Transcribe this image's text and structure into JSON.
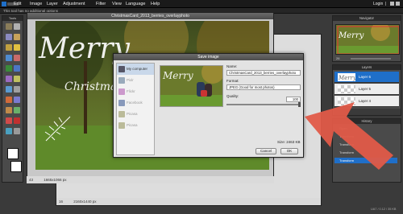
{
  "menu": [
    "Edit",
    "Image",
    "Layer",
    "Adjustment",
    "Filter",
    "View",
    "Language",
    "Help"
  ],
  "right_links": [
    "Login",
    "|"
  ],
  "info_text": "This tool has no additional options",
  "tools_title": "Tools",
  "document": {
    "title": "ChristmasCard_2013_berries_overlayphoto",
    "zoom": "43",
    "size": "1665x1066 px"
  },
  "document2": {
    "zoom": "16",
    "size": "2160x1440 px"
  },
  "overlay_text": [
    "Merry",
    "Christmas"
  ],
  "dialog": {
    "title": "Save image",
    "sources": [
      "My computer",
      "Pixlr",
      "Flickr",
      "Facebook",
      "Picasa",
      "Picasa"
    ],
    "name_label": "Name:",
    "name_value": "ChristmasCard_2013_berries_overlayphoto",
    "format_label": "Format:",
    "format_value": "JPEG (Good for most photos)",
    "quality_label": "Quality:",
    "quality_value": "100",
    "size_text": "Size: 2463 KB",
    "cancel_label": "Cancel",
    "ok_label": "OK"
  },
  "navigator": {
    "title": "Navigator",
    "zoom": "26"
  },
  "layers": {
    "title": "Layers",
    "items": [
      "Layer 6",
      "Layer 5",
      "Layer 4"
    ]
  },
  "history": {
    "title": "History",
    "items": [
      "Open",
      "Transform",
      "Transform",
      "Transform",
      "Transform"
    ]
  },
  "footer_right": "UA7 / 0.12 / 35 KB",
  "colors": {
    "accent": "#1f6fc9",
    "arrow": "#e05a48"
  }
}
